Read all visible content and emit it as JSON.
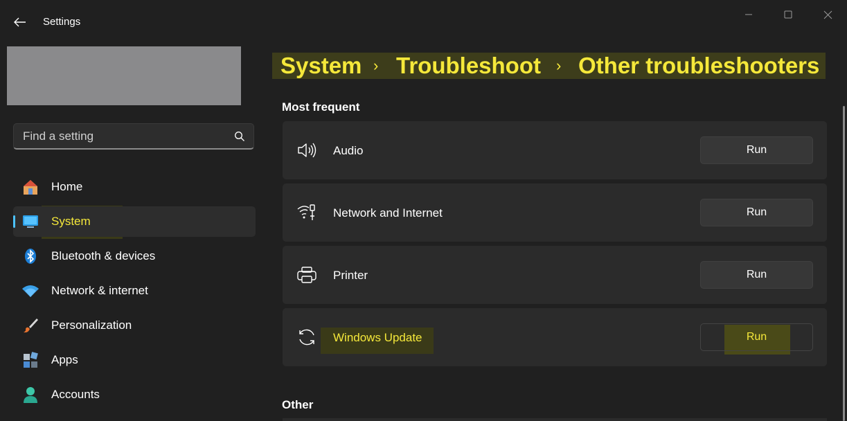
{
  "window": {
    "title": "Settings",
    "controls": [
      "minimize",
      "maximize",
      "close"
    ]
  },
  "search": {
    "placeholder": "Find a setting",
    "icon": "search-icon"
  },
  "sidebar": {
    "items": [
      {
        "label": "Home",
        "icon": "home-icon",
        "selected": false
      },
      {
        "label": "System",
        "icon": "system-display-icon",
        "selected": true
      },
      {
        "label": "Bluetooth & devices",
        "icon": "bluetooth-icon",
        "selected": false
      },
      {
        "label": "Network & internet",
        "icon": "wifi-icon",
        "selected": false
      },
      {
        "label": "Personalization",
        "icon": "paintbrush-icon",
        "selected": false
      },
      {
        "label": "Apps",
        "icon": "apps-icon",
        "selected": false
      },
      {
        "label": "Accounts",
        "icon": "account-icon",
        "selected": false
      }
    ]
  },
  "breadcrumb": {
    "items": [
      "System",
      "Troubleshoot",
      "Other troubleshooters"
    ],
    "separator": "›"
  },
  "main": {
    "sections": [
      {
        "title": "Most frequent",
        "items": [
          {
            "label": "Audio",
            "icon": "speaker-icon",
            "button": "Run"
          },
          {
            "label": "Network and Internet",
            "icon": "network-icon",
            "button": "Run"
          },
          {
            "label": "Printer",
            "icon": "printer-icon",
            "button": "Run"
          },
          {
            "label": "Windows Update",
            "icon": "sync-icon",
            "button": "Run"
          }
        ]
      },
      {
        "title": "Other",
        "items": []
      }
    ]
  },
  "colors": {
    "background": "#202020",
    "card": "#2b2b2b",
    "accent": "#4cc2ff",
    "highlight_text": "#f5e83a",
    "highlight_band": "#3d3d1b"
  }
}
